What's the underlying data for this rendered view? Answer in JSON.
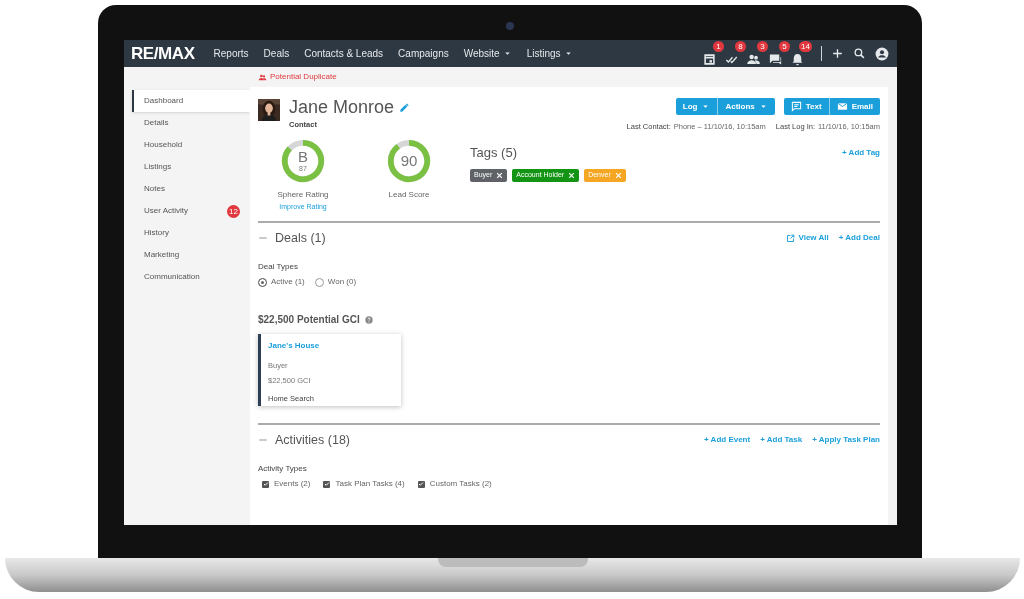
{
  "navbar": {
    "logo": "RE/MAX",
    "items": [
      {
        "label": "Reports",
        "dropdown": false
      },
      {
        "label": "Deals",
        "dropdown": false
      },
      {
        "label": "Contacts & Leads",
        "dropdown": false
      },
      {
        "label": "Campaigns",
        "dropdown": false
      },
      {
        "label": "Website",
        "dropdown": true
      },
      {
        "label": "Listings",
        "dropdown": true
      }
    ],
    "icons": [
      {
        "kind": "calendar",
        "badge": "1"
      },
      {
        "kind": "checks",
        "badge": "8"
      },
      {
        "kind": "people",
        "badge": "3"
      },
      {
        "kind": "chat",
        "badge": "5"
      },
      {
        "kind": "bell",
        "badge": "14"
      }
    ]
  },
  "alert": "Potential Duplicate",
  "sidebar": {
    "items": [
      {
        "label": "Dashboard",
        "selected": true
      },
      {
        "label": "Details",
        "selected": false
      },
      {
        "label": "Household",
        "selected": false
      },
      {
        "label": "Listings",
        "selected": false
      },
      {
        "label": "Notes",
        "selected": false
      },
      {
        "label": "User Activity",
        "selected": false,
        "badge": "12"
      },
      {
        "label": "History",
        "selected": false
      },
      {
        "label": "Marketing",
        "selected": false
      },
      {
        "label": "Communication",
        "selected": false
      }
    ]
  },
  "contact": {
    "name": "Jane Monroe",
    "type": "Contact",
    "buttons": [
      "Log",
      "Actions",
      "Text",
      "Email"
    ],
    "last_contact_label": "Last Contact:",
    "last_contact": "Phone – 11/10/16, 10:15am",
    "last_login_label": "Last Log In:",
    "last_login": "11/10/16, 10:15am"
  },
  "scores": [
    {
      "kind": "grade",
      "grade": "B",
      "value": "87",
      "label": "Sphere Rating",
      "link": "Improve Rating"
    },
    {
      "kind": "score",
      "value": "90",
      "label": "Lead Score"
    }
  ],
  "tags": {
    "title": "Tags (5)",
    "add": "+ Add Tag",
    "items": [
      {
        "label": "Buyer",
        "color": "#5f6368"
      },
      {
        "label": "Account Holder",
        "color": "#149414"
      },
      {
        "label": "Denver",
        "color": "#f5a623"
      }
    ]
  },
  "deals": {
    "title": "Deals (1)",
    "links": [
      "View All",
      "+ Add Deal"
    ],
    "types_label": "Deal Types",
    "types": [
      {
        "label": "Active (1)",
        "selected": true
      },
      {
        "label": "Won (0)",
        "selected": false
      }
    ],
    "gci": "$22,500 Potential GCI",
    "cards": [
      {
        "title": "Jane's House",
        "role": "Buyer",
        "gci": "$22,500 GCI",
        "stage": "Home Search"
      }
    ]
  },
  "activities": {
    "title": "Activities (18)",
    "links": [
      "+ Add Event",
      "+ Add Task",
      "+ Apply Task Plan"
    ],
    "types_label": "Activity Types",
    "types": [
      {
        "label": "Events (2)",
        "checked": true
      },
      {
        "label": "Task Plan Tasks (4)",
        "checked": true
      },
      {
        "label": "Custom Tasks (2)",
        "checked": true
      }
    ]
  }
}
